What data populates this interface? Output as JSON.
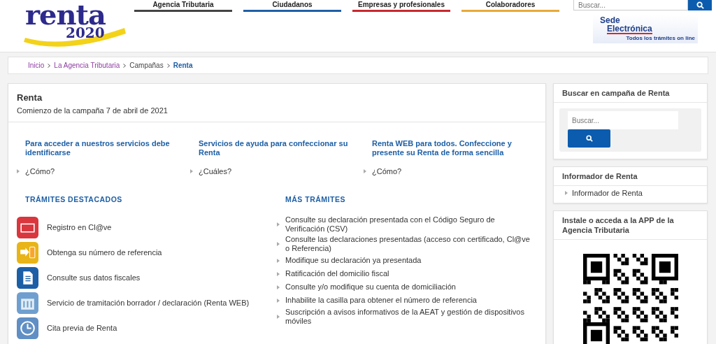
{
  "header": {
    "logo": {
      "word": "renta",
      "year": "2020"
    },
    "nav_tabs": [
      {
        "label": "Agencia Tributaria",
        "color": "#444444"
      },
      {
        "label": "Ciudadanos",
        "color": "#1f5fa8"
      },
      {
        "label": "Empresas y profesionales",
        "color": "#c8282e"
      },
      {
        "label": "Colaboradores",
        "color": "#e8a93a"
      }
    ],
    "search": {
      "placeholder": "Buscar..."
    },
    "sede": {
      "line1": "Sede",
      "line2": "Electrónica",
      "tagline": "Todos los trámites on line"
    }
  },
  "breadcrumb": [
    {
      "label": "Inicio",
      "current": false,
      "visited": true
    },
    {
      "label": "La Agencia Tributaria",
      "current": false,
      "visited": true
    },
    {
      "label": "Campañas",
      "current": false,
      "visited": false
    },
    {
      "label": "Renta",
      "current": true,
      "visited": false
    }
  ],
  "main": {
    "title": "Renta",
    "subtitle": "Comienzo de la campaña 7 de abril de 2021",
    "columns": [
      {
        "heading": "Para acceder a nuestros servicios debe identificarse",
        "link": "¿Cómo?"
      },
      {
        "heading": "Servicios de ayuda para confeccionar su Renta",
        "link": "¿Cuáles?"
      },
      {
        "heading": "Renta WEB para todos. Confeccione y presente su Renta de forma sencilla",
        "link": "¿Cómo?"
      }
    ],
    "featured": {
      "heading": "TRÁMITES DESTACADOS",
      "items": [
        {
          "label": "Registro en Cl@ve",
          "kind": "pin"
        },
        {
          "label": "Obtenga su número de referencia",
          "kind": "phone"
        },
        {
          "label": "Consulte sus datos fiscales",
          "kind": "document"
        },
        {
          "label": "Servicio de tramitación borrador / declaración (Renta WEB)",
          "kind": "web"
        },
        {
          "label": "Cita previa de Renta",
          "kind": "clock"
        }
      ]
    },
    "more": {
      "heading": "MÁS TRÁMITES",
      "items": [
        "Consulte su declaración presentada con el Código Seguro de Verificación (CSV)",
        "Consulte las declaraciones presentadas (acceso con certificado, Cl@ve o Referencia)",
        "Modifique su declaración ya presentada",
        "Ratificación del domicilio fiscal",
        "Consulte y/o modifique su cuenta de domiciliación",
        "Inhabilite la casilla para obtener el número de referencia",
        "Suscripción a avisos informativos de la AEAT y gestión de dispositivos móviles"
      ]
    }
  },
  "sidebar": {
    "search_panel": {
      "title": "Buscar en campaña de Renta",
      "placeholder": "Buscar..."
    },
    "info_panel": {
      "title": "Informador de Renta",
      "link": "Informador de Renta"
    },
    "app_panel": {
      "title": "Instale o acceda a la APP de la Agencia Tributaria"
    }
  }
}
